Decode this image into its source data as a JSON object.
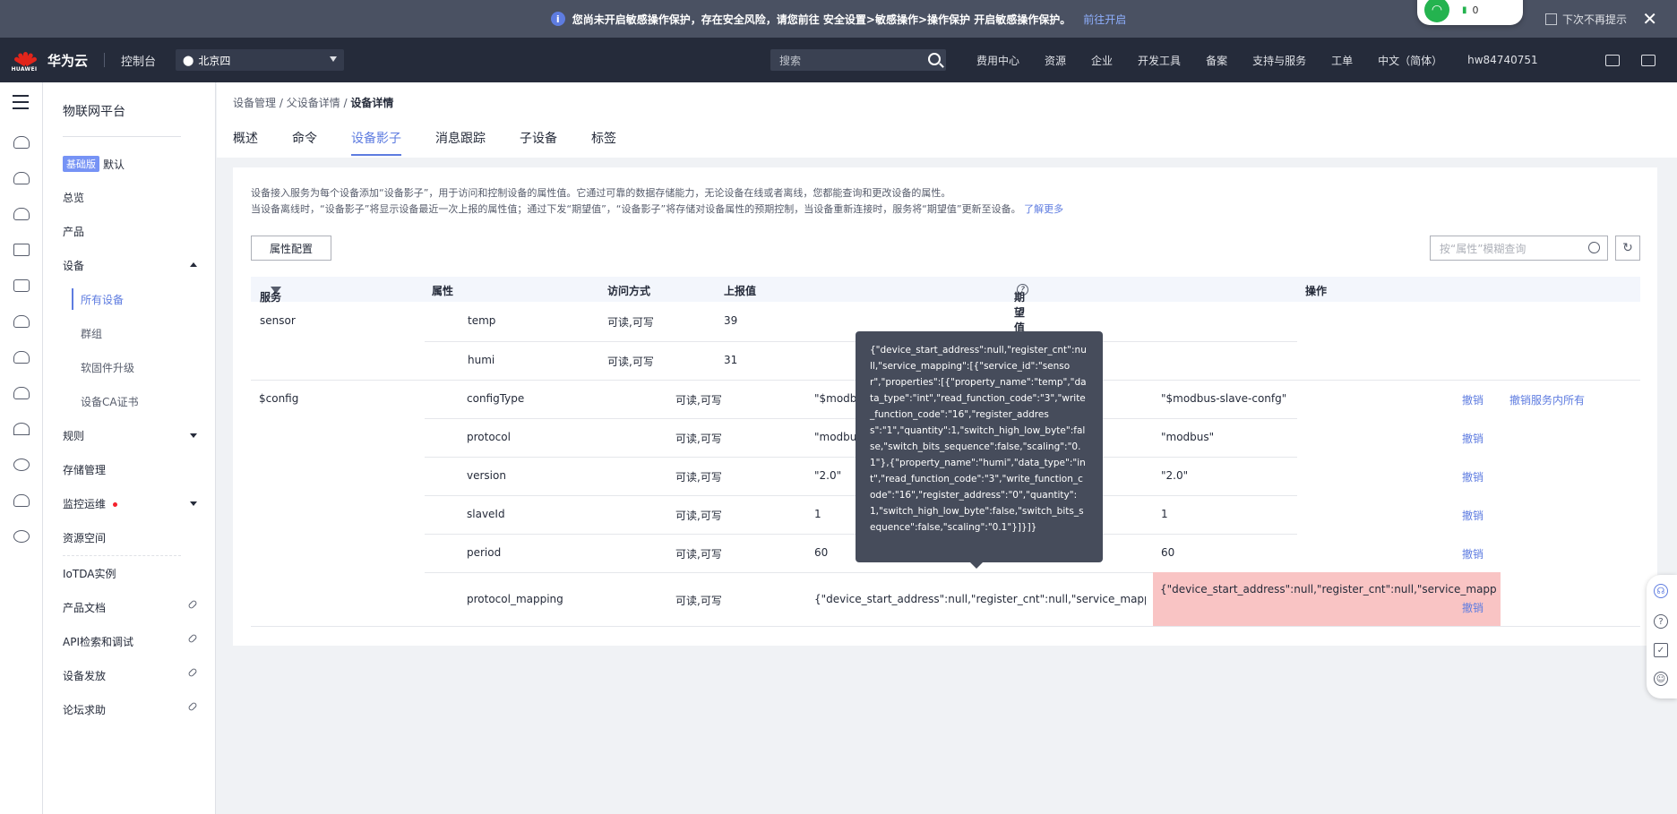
{
  "notice": {
    "message": "您尚未开启敏感操作保护，存在安全风险，请您前往 安全设置>敏感操作>操作保护 开启敏感操作保护。",
    "link": "前往开启",
    "dont_show": "下次不再提示",
    "wifi_count": "0"
  },
  "topnav": {
    "logo_text": "HUAWEI",
    "brand": "华为云",
    "console": "控制台",
    "region": "北京四",
    "search_placeholder": "搜索",
    "links": [
      "费用中心",
      "资源",
      "企业",
      "开发工具",
      "备案",
      "支持与服务",
      "工单",
      "中文（简体）",
      "hw84740751"
    ]
  },
  "sidebar": {
    "title": "物联网平台",
    "edition_badge": "基础版",
    "edition_name": "默认",
    "items": {
      "overview": "总览",
      "product": "产品",
      "device": "设备",
      "all_devices": "所有设备",
      "group": "群组",
      "firmware": "软固件升级",
      "ca_cert": "设备CA证书",
      "rules": "规则",
      "storage": "存储管理",
      "monitor": "监控运维",
      "resource_space": "资源空间",
      "iotda": "IoTDA实例",
      "product_doc": "产品文档",
      "api": "API检索和调试",
      "provision": "设备发放",
      "forum": "论坛求助"
    }
  },
  "breadcrumb": [
    "设备管理",
    "父设备详情",
    "设备详情"
  ],
  "tabs": [
    "概述",
    "命令",
    "设备影子",
    "消息跟踪",
    "子设备",
    "标签"
  ],
  "shadow": {
    "desc_line1": "设备接入服务为每个设备添加“设备影子”，用于访问和控制设备的属性值。它通过可靠的数据存储能力，无论设备在线或者离线，您都能查询和更改设备的属性。",
    "desc_line2": "当设备离线时，“设备影子”将显示设备最近一次上报的属性值；通过下发“期望值”，“设备影子”将存储对设备属性的预期控制，当设备重新连接时，服务将“期望值”更新至设备。",
    "learn_more": "了解更多",
    "config_button": "属性配置",
    "filter_placeholder": "按“属性”模糊查询",
    "columns": [
      "服务",
      "属性",
      "访问方式",
      "上报值",
      "期望值",
      "操作"
    ],
    "rows": [
      {
        "service": "sensor",
        "property": "temp",
        "access": "可读,可写",
        "reported": "39",
        "desired": "",
        "op": ""
      },
      {
        "service": "",
        "property": "humi",
        "access": "可读,可写",
        "reported": "31",
        "desired": "",
        "op": ""
      },
      {
        "service": "$config",
        "property": "configType",
        "access": "可读,可写",
        "reported": "\"$modbus",
        "desired": "\"$modbus-slave-confg\"",
        "op": "撤销"
      },
      {
        "service": "",
        "property": "protocol",
        "access": "可读,可写",
        "reported": "\"modbus",
        "desired": "\"modbus\"",
        "op": "撤销"
      },
      {
        "service": "",
        "property": "version",
        "access": "可读,可写",
        "reported": "\"2.0\"",
        "desired": "\"2.0\"",
        "op": "撤销"
      },
      {
        "service": "",
        "property": "slaveId",
        "access": "可读,可写",
        "reported": "1",
        "desired": "1",
        "op": "撤销"
      },
      {
        "service": "",
        "property": "period",
        "access": "可读,可写",
        "reported": "60",
        "desired": "60",
        "op": "撤销"
      },
      {
        "service": "",
        "property": "protocol_mapping",
        "access": "可读,可写",
        "reported": "{\"device_start_address\":null,\"register_cnt\":null,\"service_mapping\":[...",
        "desired": "{\"device_start_address\":null,\"register_cnt\":null,\"service_mapping\":[{\"ser",
        "op": "撤销"
      }
    ],
    "revoke_all": "撤销服务内所有",
    "tooltip": "{\"device_start_address\":null,\"register_cnt\":null,\"service_mapping\":[{\"service_id\":\"sensor\",\"properties\":[{\"property_name\":\"temp\",\"data_type\":\"int\",\"read_function_code\":\"3\",\"write_function_code\":\"16\",\"register_address\":\"1\",\"quantity\":1,\"switch_high_low_byte\":false,\"switch_bits_sequence\":false,\"scaling\":\"0.1\"},{\"property_name\":\"humi\",\"data_type\":\"int\",\"read_function_code\":\"3\",\"write_function_code\":\"16\",\"register_address\":\"0\",\"quantity\":1,\"switch_high_low_byte\":false,\"switch_bits_sequence\":false,\"scaling\":\"0.1\"}]}]}"
  }
}
